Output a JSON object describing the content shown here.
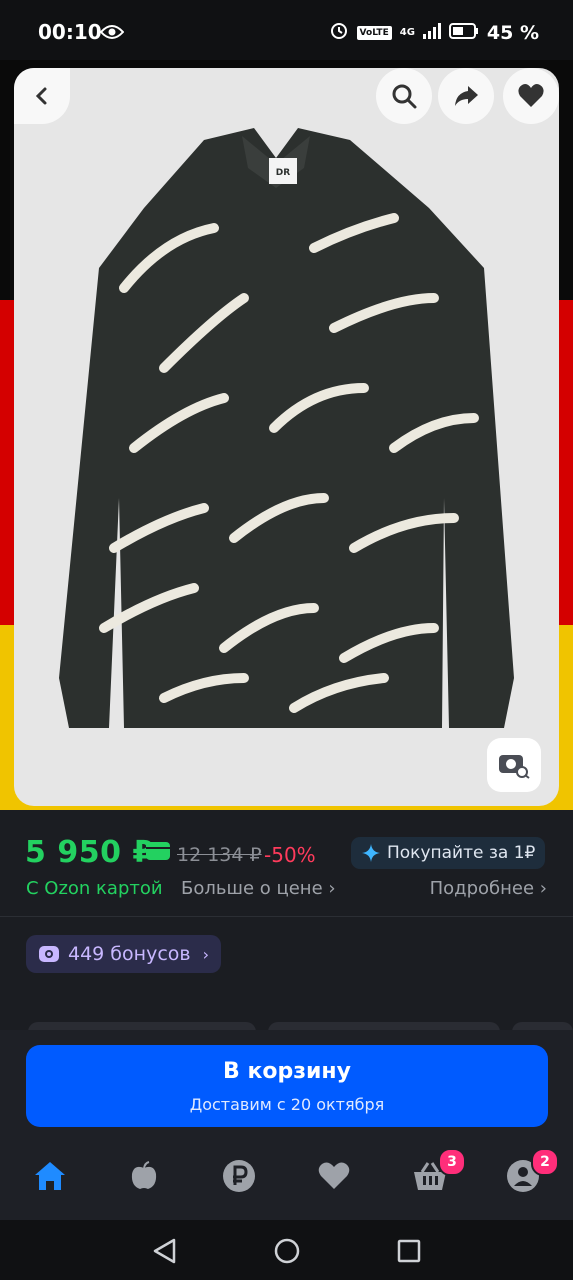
{
  "status_bar": {
    "time": "00:10",
    "network": "4G",
    "volte": "VoLTE",
    "battery": "45 %"
  },
  "product": {
    "image": "patterned-shirt-photo",
    "label_text": "DR"
  },
  "price": {
    "current": "5 950 ₽",
    "old": "12 134 ₽",
    "discount": "-50%",
    "buy_badge": "Покупайте за 1₽",
    "ozon_card": "С Ozon картой",
    "more_about_price": "Больше о цене",
    "details": "Подробнее",
    "bonuses": "449 бонусов"
  },
  "cart": {
    "title": "В корзину",
    "subtitle": "Доставим с 20 октября"
  },
  "tabs": {
    "cart_count": "3",
    "profile_count": "2"
  },
  "colors": {
    "accent": "#005bff",
    "price_green": "#23d160",
    "discount_red": "#ff3b5c",
    "badge_pink": "#ff2e7a"
  }
}
